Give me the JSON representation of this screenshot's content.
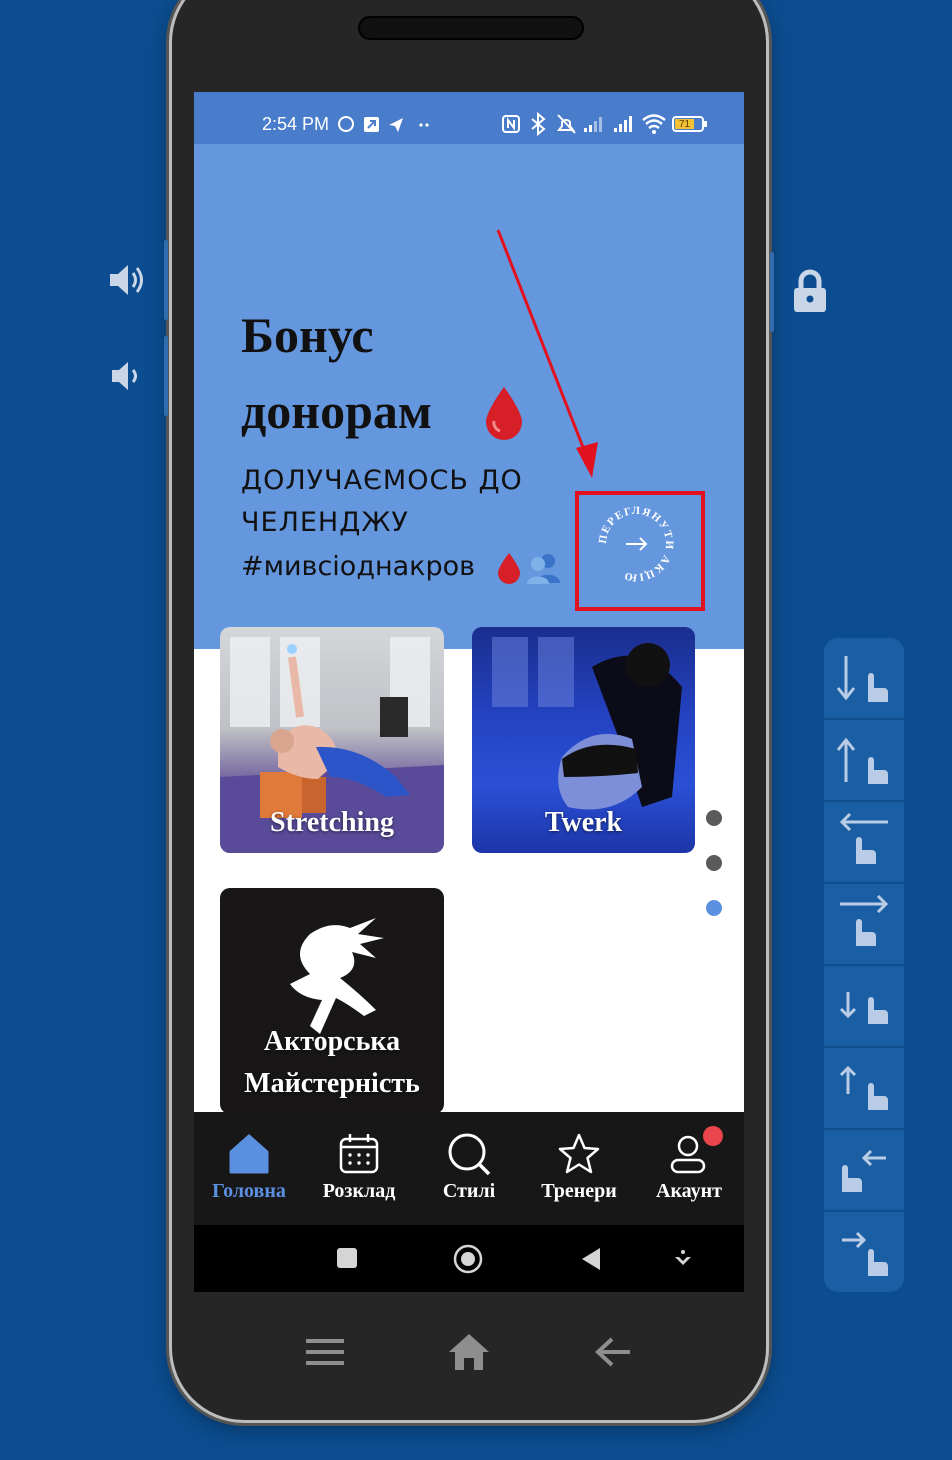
{
  "status": {
    "time": "2:54 PM",
    "battery": "71"
  },
  "hero": {
    "title_line1": "Бонус",
    "title_line2": "донорам",
    "subtitle_line1": "ДОЛУЧАЄМОСЬ ДО",
    "subtitle_line2": "ЧЕЛЕНДЖУ",
    "subtitle_line3": "#мивсіоднакров",
    "badge_text": "ПЕРЕГЛЯНУТИ АКЦІЮ"
  },
  "styles": [
    {
      "label": "Stretching"
    },
    {
      "label": "Twerk"
    },
    {
      "label_line1": "Акторська",
      "label_line2": "Майстерність"
    }
  ],
  "pager": {
    "count": 3,
    "active": 3
  },
  "tabs": [
    {
      "label": "Головна",
      "icon": "home-icon",
      "active": true
    },
    {
      "label": "Розклад",
      "icon": "calendar-icon",
      "active": false
    },
    {
      "label": "Стилі",
      "icon": "search-icon",
      "active": false
    },
    {
      "label": "Тренери",
      "icon": "star-icon",
      "active": false
    },
    {
      "label": "Акаунт",
      "icon": "account-icon",
      "active": false,
      "notification": true
    }
  ],
  "colors": {
    "background": "#0b4d90",
    "hero": "#6597df",
    "statusbar": "#4a7ccc",
    "accent": "#5b8fe0",
    "highlight": "#e3111f"
  }
}
